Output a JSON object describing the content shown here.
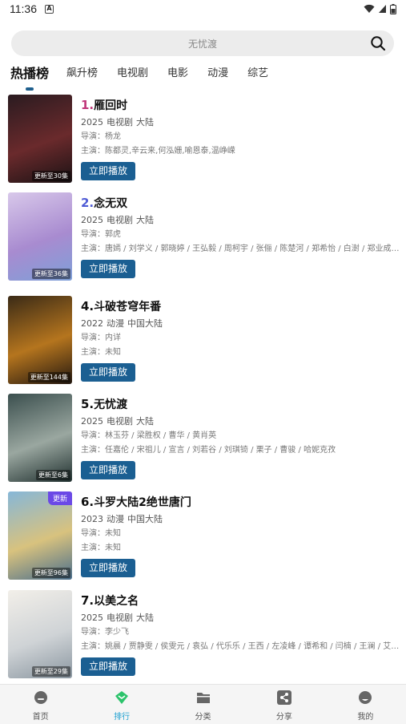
{
  "status": {
    "time": "11:36",
    "notification_icon": "a-badge-icon"
  },
  "search": {
    "placeholder": "无忧渡",
    "icon": "search-icon"
  },
  "tabs": [
    {
      "label": "热播榜",
      "active": true
    },
    {
      "label": "飙升榜",
      "active": false
    },
    {
      "label": "电视剧",
      "active": false
    },
    {
      "label": "电影",
      "active": false
    },
    {
      "label": "动漫",
      "active": false
    },
    {
      "label": "综艺",
      "active": false
    }
  ],
  "items": [
    {
      "rank": "1.",
      "rank_color": "#c0367a",
      "title": "雁回时",
      "year": "2025",
      "type": "电视剧",
      "region": "大陆",
      "director": "导演：杨龙",
      "cast": "主演：陈都灵,辛云来,何泓姗,喻恩泰,温峥嵘",
      "poster_label": "更新至30集",
      "badge": "",
      "play": "立即播放",
      "poster_colors": [
        "#2a1b20",
        "#6a2a2c",
        "#1a1214"
      ]
    },
    {
      "rank": "2.",
      "rank_color": "#4f5bd5",
      "title": "念无双",
      "year": "2025",
      "type": "电视剧",
      "region": "大陆",
      "director": "导演：郭虎",
      "cast": "主演：唐嫣 / 刘学义 / 郭晓婷 / 王弘毅 / 周柯宇 / 张俪 / 陈楚河 / 郑希怡 / 白澍 / 郑业成 / ...",
      "poster_label": "更新至36集",
      "badge": "",
      "play": "立即播放",
      "poster_colors": [
        "#d8c8ea",
        "#a88bd0",
        "#7ea0d8"
      ]
    },
    {
      "rank": "4.",
      "rank_color": "#111111",
      "title": "斗破苍穹年番",
      "year": "2022",
      "type": "动漫",
      "region": "中国大陆",
      "director": "导演：内详",
      "cast": "主演：未知",
      "poster_label": "更新至144集",
      "badge": "",
      "play": "立即播放",
      "poster_colors": [
        "#3a2a16",
        "#b5751e",
        "#241810"
      ]
    },
    {
      "rank": "5.",
      "rank_color": "#111111",
      "title": "无忧渡",
      "year": "2025",
      "type": "电视剧",
      "region": "大陆",
      "director": "导演：林玉芬 / 梁胜权 / 曹华 / 黄肖英",
      "cast": "主演：任嘉伦 / 宋祖儿 / 宣言 / 刘若谷 / 刘琪锜 / 栗子 / 曹骏 / 哈妮克孜",
      "poster_label": "更新至6集",
      "badge": "",
      "play": "立即播放",
      "poster_colors": [
        "#3b4f4e",
        "#9aa7a0",
        "#20302f"
      ]
    },
    {
      "rank": "6.",
      "rank_color": "#111111",
      "title": "斗罗大陆2绝世唐门",
      "year": "2023",
      "type": "动漫",
      "region": "中国大陆",
      "director": "导演：未知",
      "cast": "主演：未知",
      "poster_label": "更新至96集",
      "badge": "更新",
      "play": "立即播放",
      "poster_colors": [
        "#86b7d8",
        "#d8c27e",
        "#4a6e8c"
      ]
    },
    {
      "rank": "7.",
      "rank_color": "#111111",
      "title": "以美之名",
      "year": "2025",
      "type": "电视剧",
      "region": "大陆",
      "director": "导演：李少飞",
      "cast": "主演：姚晨 / 贾静雯 / 侯雯元 / 袁弘 / 代乐乐 / 王西 / 左凌峰 / 谭希和 / 闫楠 / 王澜 / 艾丽...",
      "poster_label": "更新至29集",
      "badge": "",
      "play": "立即播放",
      "poster_colors": [
        "#f2efe9",
        "#cfd3d6",
        "#8a96a0"
      ]
    }
  ],
  "nav": [
    {
      "label": "首页",
      "icon": "home-icon",
      "active": false
    },
    {
      "label": "排行",
      "icon": "ranking-icon",
      "active": true
    },
    {
      "label": "分类",
      "icon": "folder-icon",
      "active": false
    },
    {
      "label": "分享",
      "icon": "share-icon",
      "active": false
    },
    {
      "label": "我的",
      "icon": "profile-icon",
      "active": false
    }
  ]
}
